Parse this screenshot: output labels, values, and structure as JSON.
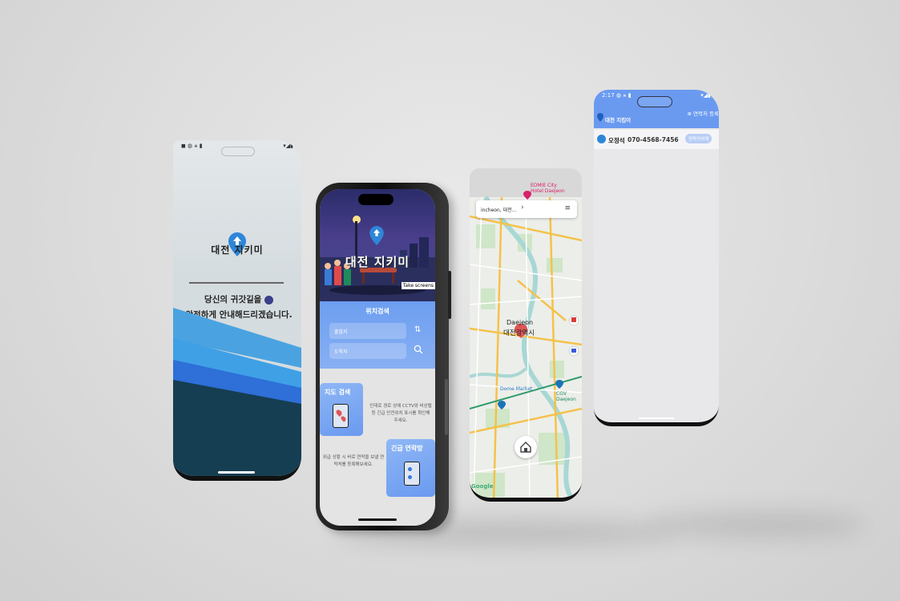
{
  "splash": {
    "status_left": "◼ ◍ ⚹ ▮",
    "status_right": "▾◢▮",
    "title": "대전 지키미",
    "message_line1": "당신의 귀갓길을",
    "message_line2": "안전하게 안내해드리겠습니다."
  },
  "main": {
    "hero_title": "대전 지키미",
    "screenshot_tag": "Take screens",
    "search_title": "위치검색",
    "origin_placeholder": "출발지",
    "destination_placeholder": "도착지",
    "map_card_title": "지도 검색",
    "map_card_desc": "인데로 경로 상에 CCTV와 비상벨 등 긴급 안전위치 표시를 확인해 주세요.",
    "emergency_card_title": "긴급 연락망",
    "emergency_card_desc": "위급 상황 시 바로 연락을 보낼 연락처를 등록해보세요."
  },
  "map": {
    "search_text": "incheon, 대전...",
    "hotel_label_line1": "EDMIE City",
    "hotel_label_line2": "Hotel Daejeon",
    "city_en": "Daejeon",
    "city_ko": "대전광역시",
    "poi_market": "Dome Market",
    "poi_cgv": "CGV Daejeon",
    "attribution": "Google"
  },
  "contacts": {
    "status_left": "2:17 ◍ ⚹ ▮",
    "app_title": "대전 지킴이",
    "add_label": "⊕ 연락처 등록",
    "entries": [
      {
        "name": "오정석",
        "phone": "070-4568-7456",
        "action": "연락처삭제"
      }
    ]
  },
  "colors": {
    "accent_blue": "#6a9af0",
    "pin_blue": "#2f86d8",
    "wave_dark": "#163e52",
    "wave_light": "#3e8bd6"
  }
}
